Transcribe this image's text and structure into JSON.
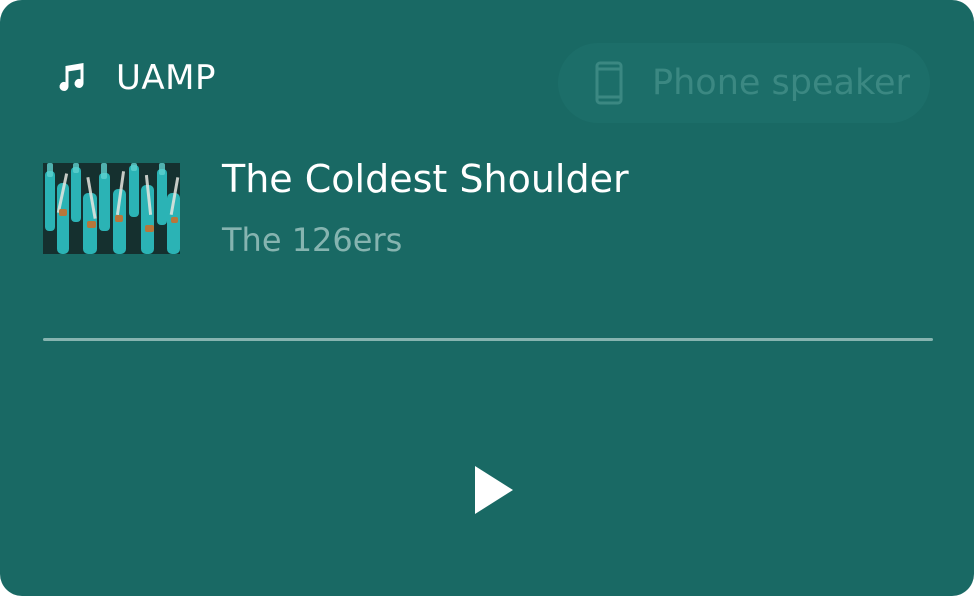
{
  "header": {
    "app_icon": "music-note-icon",
    "app_name": "UAMP"
  },
  "output_device": {
    "icon": "smartphone-icon",
    "label": "Phone speaker"
  },
  "track": {
    "artwork": "album-art-teal-bottles",
    "title": "The Coldest Shoulder",
    "artist": "The 126ers"
  },
  "playback": {
    "progress": 0,
    "state": "paused",
    "play_icon": "play-icon"
  },
  "colors": {
    "background": "#196964",
    "primary_text": "#ffffff",
    "secondary_text": "#86b4b0",
    "disabled_text": "#3f8c86"
  }
}
